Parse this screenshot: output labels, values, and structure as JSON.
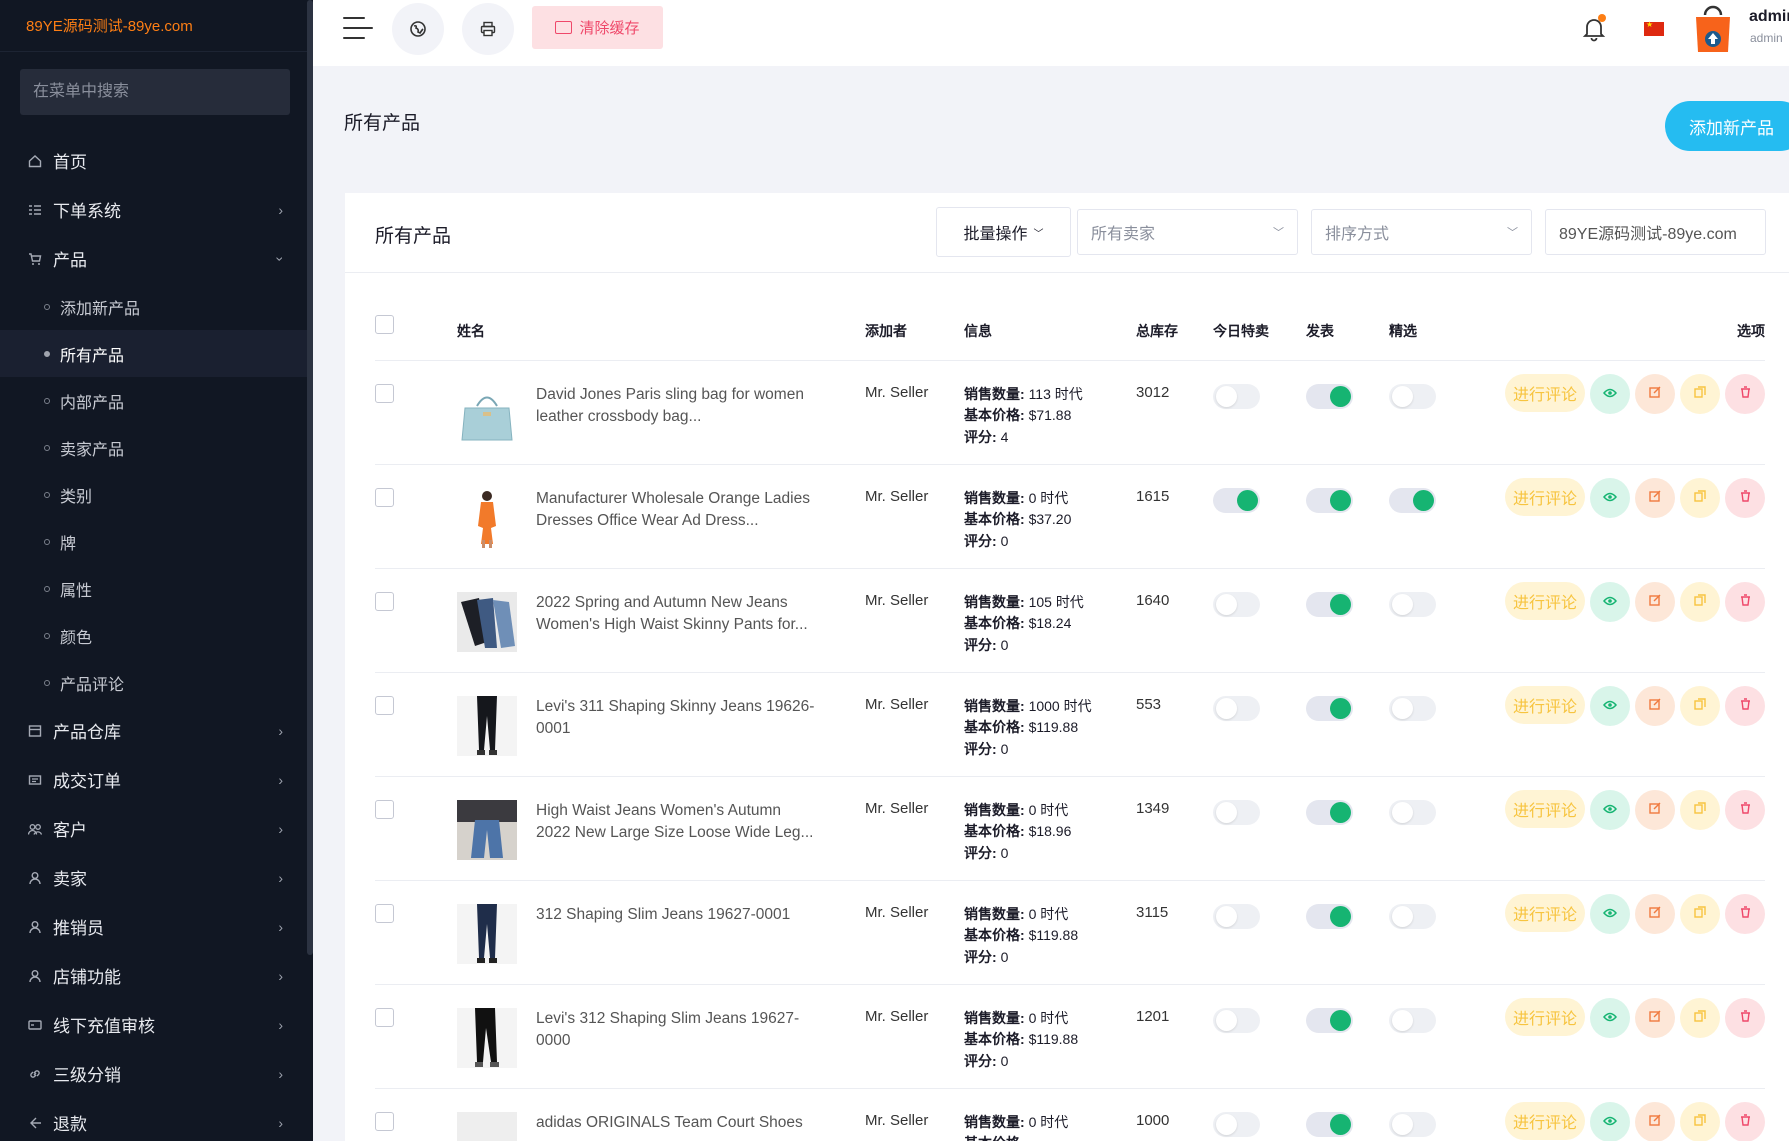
{
  "brand": "89YE源码测试-89ye.com",
  "sidebar": {
    "search_placeholder": "在菜单中搜索",
    "menu": [
      {
        "label": "首页",
        "icon": "home-icon"
      },
      {
        "label": "下单系统",
        "icon": "list-icon"
      },
      {
        "label": "产品",
        "icon": "cart-icon"
      },
      {
        "label": "产品仓库",
        "icon": "warehouse-icon"
      },
      {
        "label": "成交订单",
        "icon": "receipt-icon"
      },
      {
        "label": "客户",
        "icon": "users-icon"
      },
      {
        "label": "卖家",
        "icon": "user-icon"
      },
      {
        "label": "推销员",
        "icon": "user-icon"
      },
      {
        "label": "店铺功能",
        "icon": "user-icon"
      },
      {
        "label": "线下充值审核",
        "icon": "card-icon"
      },
      {
        "label": "三级分销",
        "icon": "link-icon"
      },
      {
        "label": "退款",
        "icon": "return-icon"
      }
    ],
    "submenu": [
      "添加新产品",
      "所有产品",
      "内部产品",
      "卖家产品",
      "类别",
      "牌",
      "属性",
      "颜色",
      "产品评论"
    ]
  },
  "topbar": {
    "clear_cache": "清除缓存",
    "user_name": "admin",
    "user_role": "admin",
    "accent": "#fd7e14"
  },
  "page": {
    "title": "所有产品",
    "add_button": "添加新产品"
  },
  "card": {
    "title": "所有产品",
    "bulk_action": "批量操作",
    "seller_filter_placeholder": "所有卖家",
    "sort_placeholder": "排序方式",
    "search_value": "89YE源码测试-89ye.com"
  },
  "table": {
    "headers": {
      "name": "姓名",
      "added_by": "添加者",
      "info": "信息",
      "stock": "总库存",
      "todays_deal": "今日特卖",
      "published": "发表",
      "featured": "精选",
      "options": "选项"
    },
    "info_labels": {
      "sales": "销售数量:",
      "unit": "时代",
      "price": "基本价格:",
      "rating": "评分:"
    },
    "review_label": "进行评论",
    "rows": [
      {
        "name": "David Jones Paris sling bag for women leather crossbody bag...",
        "added_by": "Mr. Seller",
        "sales": "113",
        "price": "$71.88",
        "rating": "4",
        "stock": "3012",
        "deal": false,
        "published": true,
        "featured": false,
        "img": "bag"
      },
      {
        "name": "Manufacturer Wholesale Orange Ladies Dresses Office Wear Ad Dress...",
        "added_by": "Mr. Seller",
        "sales": "0",
        "price": "$37.20",
        "rating": "0",
        "stock": "1615",
        "deal": true,
        "published": true,
        "featured": true,
        "img": "dress"
      },
      {
        "name": "2022 Spring and Autumn New Jeans Women's High Waist Skinny Pants for...",
        "added_by": "Mr. Seller",
        "sales": "105",
        "price": "$18.24",
        "rating": "0",
        "stock": "1640",
        "deal": false,
        "published": true,
        "featured": false,
        "img": "jeans-flat"
      },
      {
        "name": "Levi's 311 Shaping Skinny Jeans 19626-0001",
        "added_by": "Mr. Seller",
        "sales": "1000",
        "price": "$119.88",
        "rating": "0",
        "stock": "553",
        "deal": false,
        "published": true,
        "featured": false,
        "img": "legs-black"
      },
      {
        "name": "High Waist Jeans Women's Autumn 2022 New Large Size Loose Wide Leg...",
        "added_by": "Mr. Seller",
        "sales": "0",
        "price": "$18.96",
        "rating": "0",
        "stock": "1349",
        "deal": false,
        "published": true,
        "featured": false,
        "img": "wide-leg"
      },
      {
        "name": "312 Shaping Slim Jeans 19627-0001",
        "added_by": "Mr. Seller",
        "sales": "0",
        "price": "$119.88",
        "rating": "0",
        "stock": "3115",
        "deal": false,
        "published": true,
        "featured": false,
        "img": "legs-navy"
      },
      {
        "name": "Levi's 312 Shaping Slim Jeans 19627-0000",
        "added_by": "Mr. Seller",
        "sales": "0",
        "price": "$119.88",
        "rating": "0",
        "stock": "1201",
        "deal": false,
        "published": true,
        "featured": false,
        "img": "legs-black2"
      },
      {
        "name": "adidas ORIGINALS Team Court Shoes",
        "added_by": "Mr. Seller",
        "sales": "0",
        "price": "",
        "rating": "",
        "stock": "1000",
        "deal": false,
        "published": true,
        "featured": false,
        "img": "shoes"
      }
    ]
  }
}
